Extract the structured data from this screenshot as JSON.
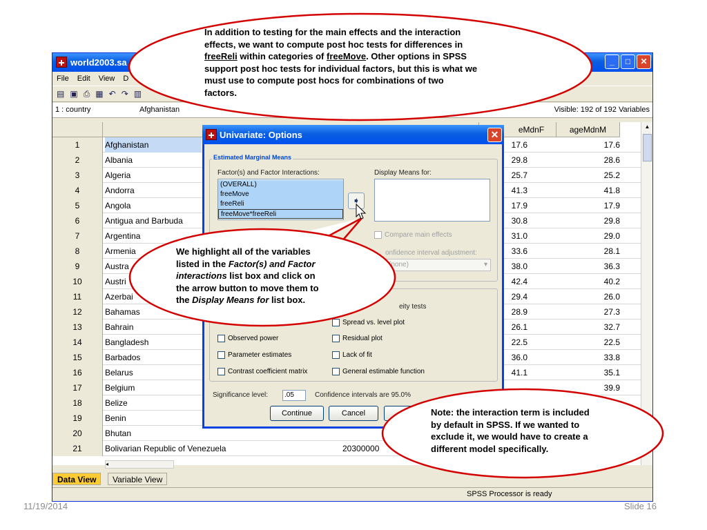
{
  "window": {
    "title": "world2003.sa",
    "menu": [
      "File",
      "Edit",
      "View",
      "D"
    ],
    "cell_ref": "1 : country",
    "cell_value": "Afghanistan",
    "visible": "Visible: 192 of 192 Variables"
  },
  "grid": {
    "col_f": "eMdnF",
    "col_m": "ageMdnM",
    "rows": [
      {
        "n": "1",
        "country": "Afghanistan",
        "f": "17.6",
        "m": "17.6"
      },
      {
        "n": "2",
        "country": "Albania",
        "f": "29.8",
        "m": "28.6"
      },
      {
        "n": "3",
        "country": "Algeria",
        "f": "25.7",
        "m": "25.2"
      },
      {
        "n": "4",
        "country": "Andorra",
        "f": "41.3",
        "m": "41.8"
      },
      {
        "n": "5",
        "country": "Angola",
        "f": "17.9",
        "m": "17.9"
      },
      {
        "n": "6",
        "country": "Antigua and Barbuda",
        "f": "30.8",
        "m": "29.8"
      },
      {
        "n": "7",
        "country": "Argentina",
        "f": "31.0",
        "m": "29.0"
      },
      {
        "n": "8",
        "country": "Armenia",
        "f": "33.6",
        "m": "28.1"
      },
      {
        "n": "9",
        "country": "Austra",
        "f": "38.0",
        "m": "36.3"
      },
      {
        "n": "10",
        "country": "Austri",
        "f": "42.4",
        "m": "40.2"
      },
      {
        "n": "11",
        "country": "Azerbai",
        "f": "29.4",
        "m": "26.0"
      },
      {
        "n": "12",
        "country": "Bahamas",
        "f": "28.9",
        "m": "27.3"
      },
      {
        "n": "13",
        "country": "Bahrain",
        "f": "26.1",
        "m": "32.7"
      },
      {
        "n": "14",
        "country": "Bangladesh",
        "f": "22.5",
        "m": "22.5"
      },
      {
        "n": "15",
        "country": "Barbados",
        "f": "36.0",
        "m": "33.8"
      },
      {
        "n": "16",
        "country": "Belarus",
        "f": "41.1",
        "m": "35.1"
      },
      {
        "n": "17",
        "country": "Belgium",
        "f": "",
        "m": "39.9"
      },
      {
        "n": "18",
        "country": "Belize",
        "f": "",
        "m": ""
      },
      {
        "n": "19",
        "country": "Benin",
        "f": "",
        "m": ""
      },
      {
        "n": "20",
        "country": "Bhutan",
        "f": "",
        "m": ""
      },
      {
        "n": "21",
        "country": "Bolivarian Republic of Venezuela",
        "f": "",
        "m": "",
        "big": "20300000"
      }
    ]
  },
  "tabs": {
    "data_view": "Data View",
    "variable_view": "Variable View"
  },
  "status": "SPSS  Processor is ready",
  "dialog": {
    "title": "Univariate: Options",
    "group_label": "Estimated Marginal Means",
    "factors_label": "Factor(s) and Factor Interactions:",
    "display_label": "Display Means for:",
    "factor_items": [
      "(OVERALL)",
      "freeMove",
      "freeReli",
      "freeMove*freeReli"
    ],
    "compare_main": "Compare main effects",
    "ci_adjust": "onfidence interval adjustment:",
    "ci_value": "(none)",
    "homogeneity": "eity tests",
    "spread_level": "Spread vs. level plot",
    "observed_power": "Observed power",
    "residual_plot": "Residual plot",
    "param_estimates": "Parameter estimates",
    "lack_of_fit": "Lack of fit",
    "contrast_matrix": "Contrast coefficient matrix",
    "general_estimable": "General estimable function",
    "significance_label": "Significance level:",
    "significance_value": ".05",
    "confidence_text": "Confidence intervals are 95.0%",
    "continue": "Continue",
    "cancel": "Cancel"
  },
  "callouts": {
    "top": {
      "line1": "In addition to testing for the main effects and the interaction",
      "line2": "effects, we want to compute post hoc tests for differences in",
      "l3a": "freeReli",
      "l3b": " within categories of ",
      "l3c": "freeMove",
      "l3d": ".  Other options in SPSS",
      "line4": "support post hoc tests for individual factors, but this is what we",
      "line5": "must use to compute post hocs for combinations of two",
      "line6": "factors."
    },
    "left": {
      "line1": "We highlight all of the variables",
      "l2a": "listed in the ",
      "l2b": "Factor(s) and Factor",
      "l3a": "interactions",
      "l3b": " list box  and click on",
      "line4": "the arrow button to move them to",
      "l5a": "the ",
      "l5b": "Display Means for",
      "l5c": " list box."
    },
    "right": {
      "line1": "Note: the interaction term is included",
      "line2": "by default in SPSS. If we wanted to",
      "line3": "exclude it, we would have to create a",
      "line4": "different model specifically."
    }
  },
  "footer": {
    "date": "11/19/2014",
    "slide": "Slide 16"
  },
  "colors": {
    "callout_border": "#d40000",
    "xp_blue": "#0a5fe0"
  }
}
